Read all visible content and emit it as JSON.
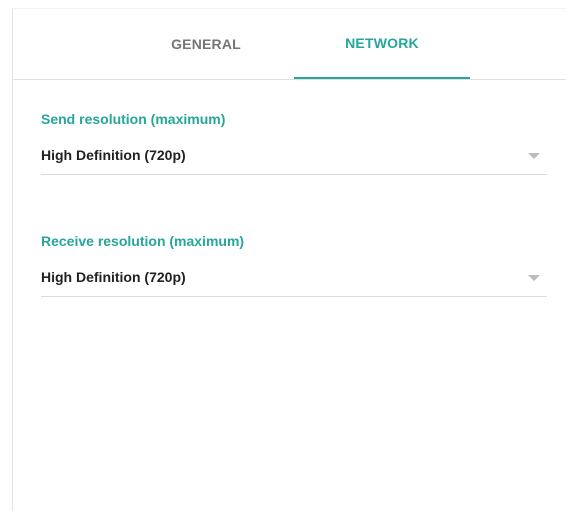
{
  "tabs": {
    "general": "GENERAL",
    "network": "NETWORK",
    "active": "network"
  },
  "send_resolution": {
    "label": "Send resolution (maximum)",
    "value": "High Definition (720p)"
  },
  "receive_resolution": {
    "label": "Receive resolution (maximum)",
    "value": "High Definition (720p)"
  },
  "colors": {
    "accent": "#26a69a",
    "inactive_tab": "#757575",
    "text": "#212121",
    "divider": "#e0e0e0"
  },
  "icons": {
    "dropdown": "chevron-down-icon"
  }
}
